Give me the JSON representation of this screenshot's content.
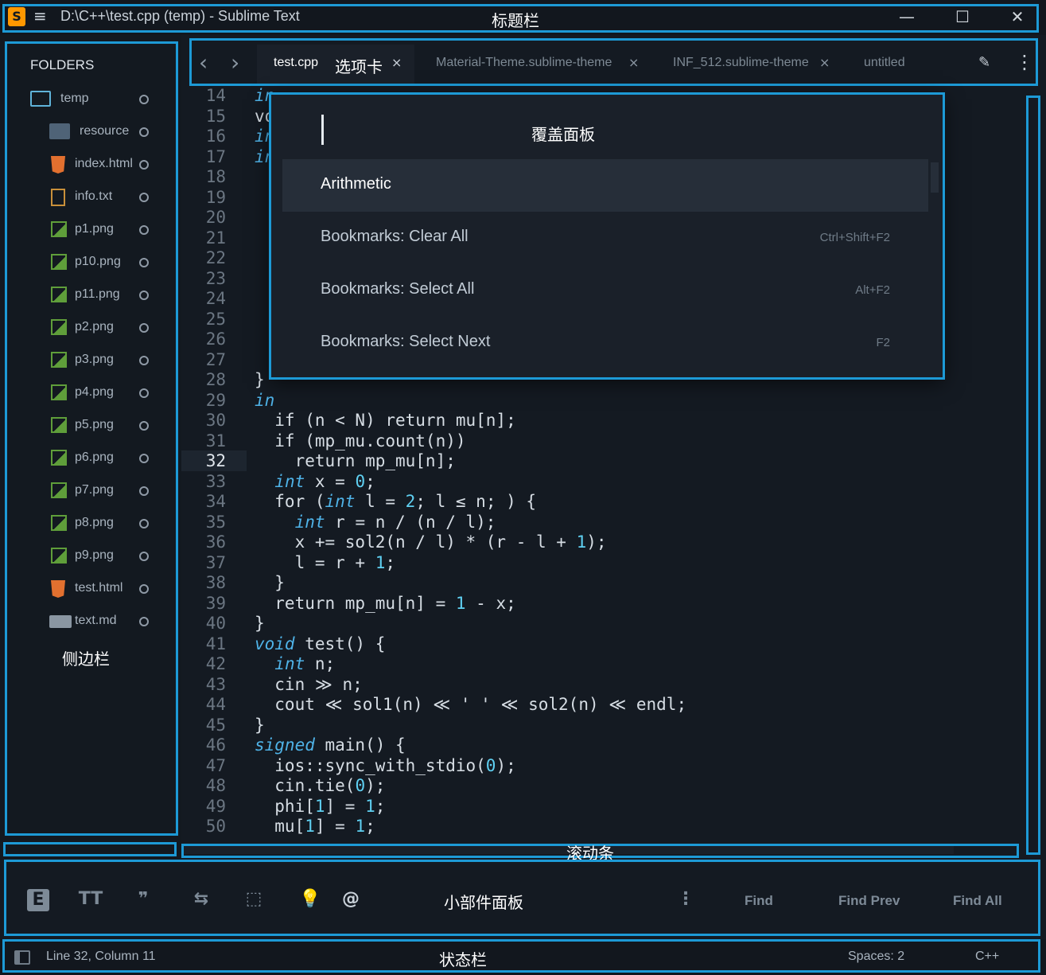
{
  "window": {
    "title": "D:\\C++\\test.cpp (temp) - Sublime Text",
    "logo_glyph": "S",
    "menu_glyph": "≡",
    "minimize": "—",
    "maximize": "☐",
    "close": "✕"
  },
  "annotations": {
    "titlebar": "标题栏",
    "tabs": "选项卡",
    "overlay": "覆盖面板",
    "sidebar": "侧边栏",
    "scrollbar": "滚动条",
    "widgets": "小部件面板",
    "statusbar": "状态栏"
  },
  "sidebar": {
    "title": "FOLDERS",
    "items": [
      {
        "label": "temp",
        "icon": "folder-open-icon"
      },
      {
        "label": "resource",
        "icon": "folder-icon"
      },
      {
        "label": "index.html",
        "icon": "html5-icon"
      },
      {
        "label": "info.txt",
        "icon": "text-file-icon"
      },
      {
        "label": "p1.png",
        "icon": "image-icon"
      },
      {
        "label": "p10.png",
        "icon": "image-icon"
      },
      {
        "label": "p11.png",
        "icon": "image-icon"
      },
      {
        "label": "p2.png",
        "icon": "image-icon"
      },
      {
        "label": "p3.png",
        "icon": "image-icon"
      },
      {
        "label": "p4.png",
        "icon": "image-icon"
      },
      {
        "label": "p5.png",
        "icon": "image-icon"
      },
      {
        "label": "p6.png",
        "icon": "image-icon"
      },
      {
        "label": "p7.png",
        "icon": "image-icon"
      },
      {
        "label": "p8.png",
        "icon": "image-icon"
      },
      {
        "label": "p9.png",
        "icon": "image-icon"
      },
      {
        "label": "test.html",
        "icon": "html5-icon"
      },
      {
        "label": "text.md",
        "icon": "markdown-icon"
      }
    ]
  },
  "tabs": {
    "back": "‹",
    "forward": "›",
    "items": [
      {
        "label": "test.cpp",
        "active": true
      },
      {
        "label": "Material-Theme.sublime-theme",
        "active": false
      },
      {
        "label": "INF_512.sublime-theme",
        "active": false
      },
      {
        "label": "untitled",
        "active": false
      }
    ],
    "close_glyph": "×",
    "edit_glyph": "✎",
    "more_glyph": "⋮"
  },
  "editor": {
    "active_line": 32,
    "lines": [
      {
        "n": "14",
        "html": "<span class=\"kw\">in</span>"
      },
      {
        "n": "15",
        "html": "vo"
      },
      {
        "n": "16",
        "html": "<span class=\"kw\">in</span>"
      },
      {
        "n": "17",
        "html": "<span class=\"kw\">in</span>"
      },
      {
        "n": "18",
        "html": ""
      },
      {
        "n": "19",
        "html": ""
      },
      {
        "n": "20",
        "html": ""
      },
      {
        "n": "21",
        "html": ""
      },
      {
        "n": "22",
        "html": ""
      },
      {
        "n": "23",
        "html": ""
      },
      {
        "n": "24",
        "html": ""
      },
      {
        "n": "25",
        "html": ""
      },
      {
        "n": "26",
        "html": ""
      },
      {
        "n": "27",
        "html": ""
      },
      {
        "n": "28",
        "html": "}"
      },
      {
        "n": "29",
        "html": "<span class=\"kw\">in</span>"
      },
      {
        "n": "30",
        "html": "  if (n &lt; N) return mu[n];"
      },
      {
        "n": "31",
        "html": "  if (mp_mu.count(n))"
      },
      {
        "n": "32",
        "html": "    return mp_mu[n];"
      },
      {
        "n": "33",
        "html": "  <span class=\"kw\">int</span> x = <span class=\"num\">0</span>;"
      },
      {
        "n": "34",
        "html": "  for (<span class=\"kw\">int</span> l = <span class=\"num\">2</span>; l ≤ n; ) {"
      },
      {
        "n": "35",
        "html": "    <span class=\"kw\">int</span> r = n / (n / l);"
      },
      {
        "n": "36",
        "html": "    x += sol2(n / l) * (r - l + <span class=\"num\">1</span>);"
      },
      {
        "n": "37",
        "html": "    l = r + <span class=\"num\">1</span>;"
      },
      {
        "n": "38",
        "html": "  }"
      },
      {
        "n": "39",
        "html": "  return mp_mu[n] = <span class=\"num\">1</span> - x;"
      },
      {
        "n": "40",
        "html": "}"
      },
      {
        "n": "41",
        "html": "<span class=\"kw\">void</span> test() {"
      },
      {
        "n": "42",
        "html": "  <span class=\"kw\">int</span> n;"
      },
      {
        "n": "43",
        "html": "  cin ≫ n;"
      },
      {
        "n": "44",
        "html": "  cout ≪ sol1(n) ≪ ' ' ≪ sol2(n) ≪ endl;"
      },
      {
        "n": "45",
        "html": "}"
      },
      {
        "n": "46",
        "html": "<span class=\"kw\">signed</span> main() {"
      },
      {
        "n": "47",
        "html": "  ios::sync_with_stdio(<span class=\"num\">0</span>);"
      },
      {
        "n": "48",
        "html": "  cin.tie(<span class=\"num\">0</span>);"
      },
      {
        "n": "49",
        "html": "  phi[<span class=\"num\">1</span>] = <span class=\"num\">1</span>;"
      },
      {
        "n": "50",
        "html": "  mu[<span class=\"num\">1</span>] = <span class=\"num\">1</span>;"
      }
    ]
  },
  "overlay": {
    "items": [
      {
        "label": "Arithmetic",
        "key": "",
        "selected": true
      },
      {
        "label": "Bookmarks: Clear All",
        "key": "Ctrl+Shift+F2",
        "selected": false
      },
      {
        "label": "Bookmarks: Select All",
        "key": "Alt+F2",
        "selected": false
      },
      {
        "label": "Bookmarks: Select Next",
        "key": "F2",
        "selected": false
      }
    ]
  },
  "widgets": {
    "regex": "E",
    "case": "TT",
    "whole_word": "❞",
    "wrap": "⇆",
    "in_selection": "⬚",
    "highlight": "💡",
    "at": "@",
    "more": "⋮",
    "find": "Find",
    "find_prev": "Find Prev",
    "find_all": "Find All"
  },
  "status": {
    "position": "Line 32, Column 11",
    "spaces": "Spaces: 2",
    "syntax": "C++"
  },
  "colors": {
    "accent": "#1d9ad6",
    "background": "#141a22"
  }
}
